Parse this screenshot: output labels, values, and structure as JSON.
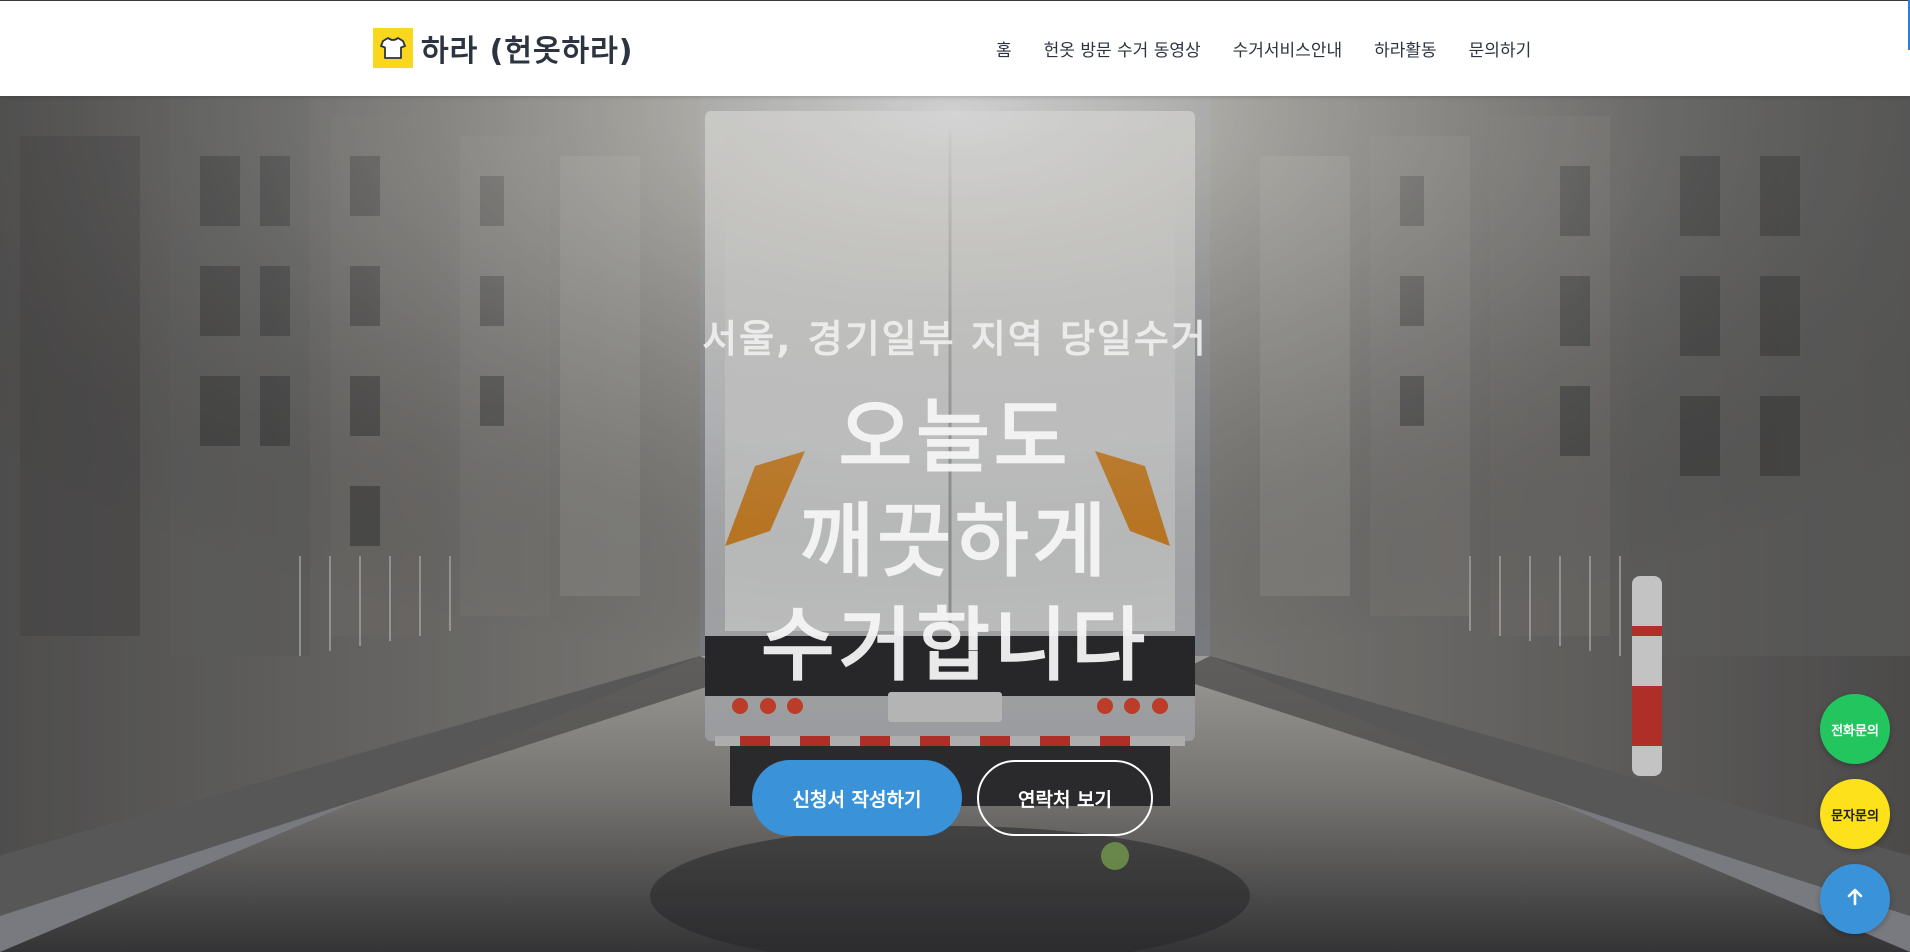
{
  "header": {
    "logo_text": "하라 (헌옷하라)",
    "logo_icon": "tshirt-icon",
    "nav": [
      {
        "label": "홈"
      },
      {
        "label": "헌옷 방문 수거 동영상"
      },
      {
        "label": "수거서비스안내"
      },
      {
        "label": "하라활동"
      },
      {
        "label": "문의하기"
      }
    ]
  },
  "hero": {
    "subtitle": "서울, 경기일부 지역 당일수거",
    "title_lines": [
      "오늘도",
      "깨끗하게",
      "수거합니다"
    ],
    "primary_button": "신청서 작성하기",
    "secondary_button": "연락처 보기"
  },
  "floating": {
    "phone_label": "전화문의",
    "sms_label": "문자문의",
    "top_icon": "arrow-up-icon"
  },
  "colors": {
    "accent_blue": "#3a92d8",
    "logo_yellow": "#f9d71c",
    "phone_green": "#22c55e",
    "sms_yellow": "#fde21b",
    "text_dark": "#2b3440"
  }
}
